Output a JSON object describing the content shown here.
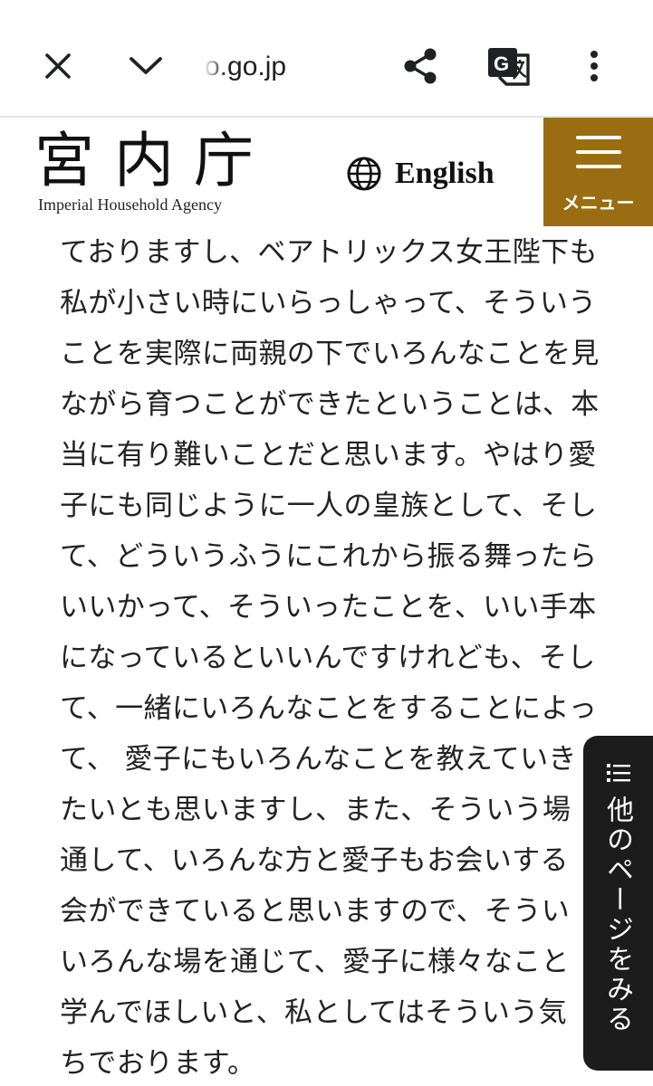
{
  "browser": {
    "url": "o.go.jp",
    "close_icon": "close-icon",
    "chevron_icon": "chevron-down-icon",
    "share_icon": "share-icon",
    "translate_icon": "google-translate-icon",
    "more_icon": "more-vertical-icon"
  },
  "header": {
    "logo_kanji": "宮内庁",
    "logo_english": "Imperial Household Agency",
    "language_label": "English",
    "language_icon": "globe-icon",
    "menu_label": "メニュー",
    "menu_icon": "hamburger-menu-icon",
    "accent_color": "#9b6d12"
  },
  "body_lines": [
    "ておりますし、ベアトリックス女王陛下も",
    "私が小さい時にいらっしゃって、そういう",
    "ことを実際に両親の下でいろんなことを見",
    "ながら育つことができたということは、本",
    "当に有り難いことだと思います。やはり愛",
    "子にも同じように一人の皇族として、そし",
    "て、どういうふうにこれから振る舞ったら",
    "いいかって、そういったことを、いい手本",
    "になっているといいんですけれども、そし",
    "て、一緒にいろんなことをすることによっ",
    "て、 愛子にもいろんなことを教えていき",
    "たいとも思いますし、また、そういう場",
    "通して、いろんな方と愛子もお会いする",
    "会ができていると思いますので、そうい",
    "いろんな場を通じて、愛子に様々なこと",
    "学んでほしいと、私としてはそういう気",
    "ちでおります。"
  ],
  "side_tab": {
    "label": "他のページをみる",
    "icon": "list-icon"
  }
}
